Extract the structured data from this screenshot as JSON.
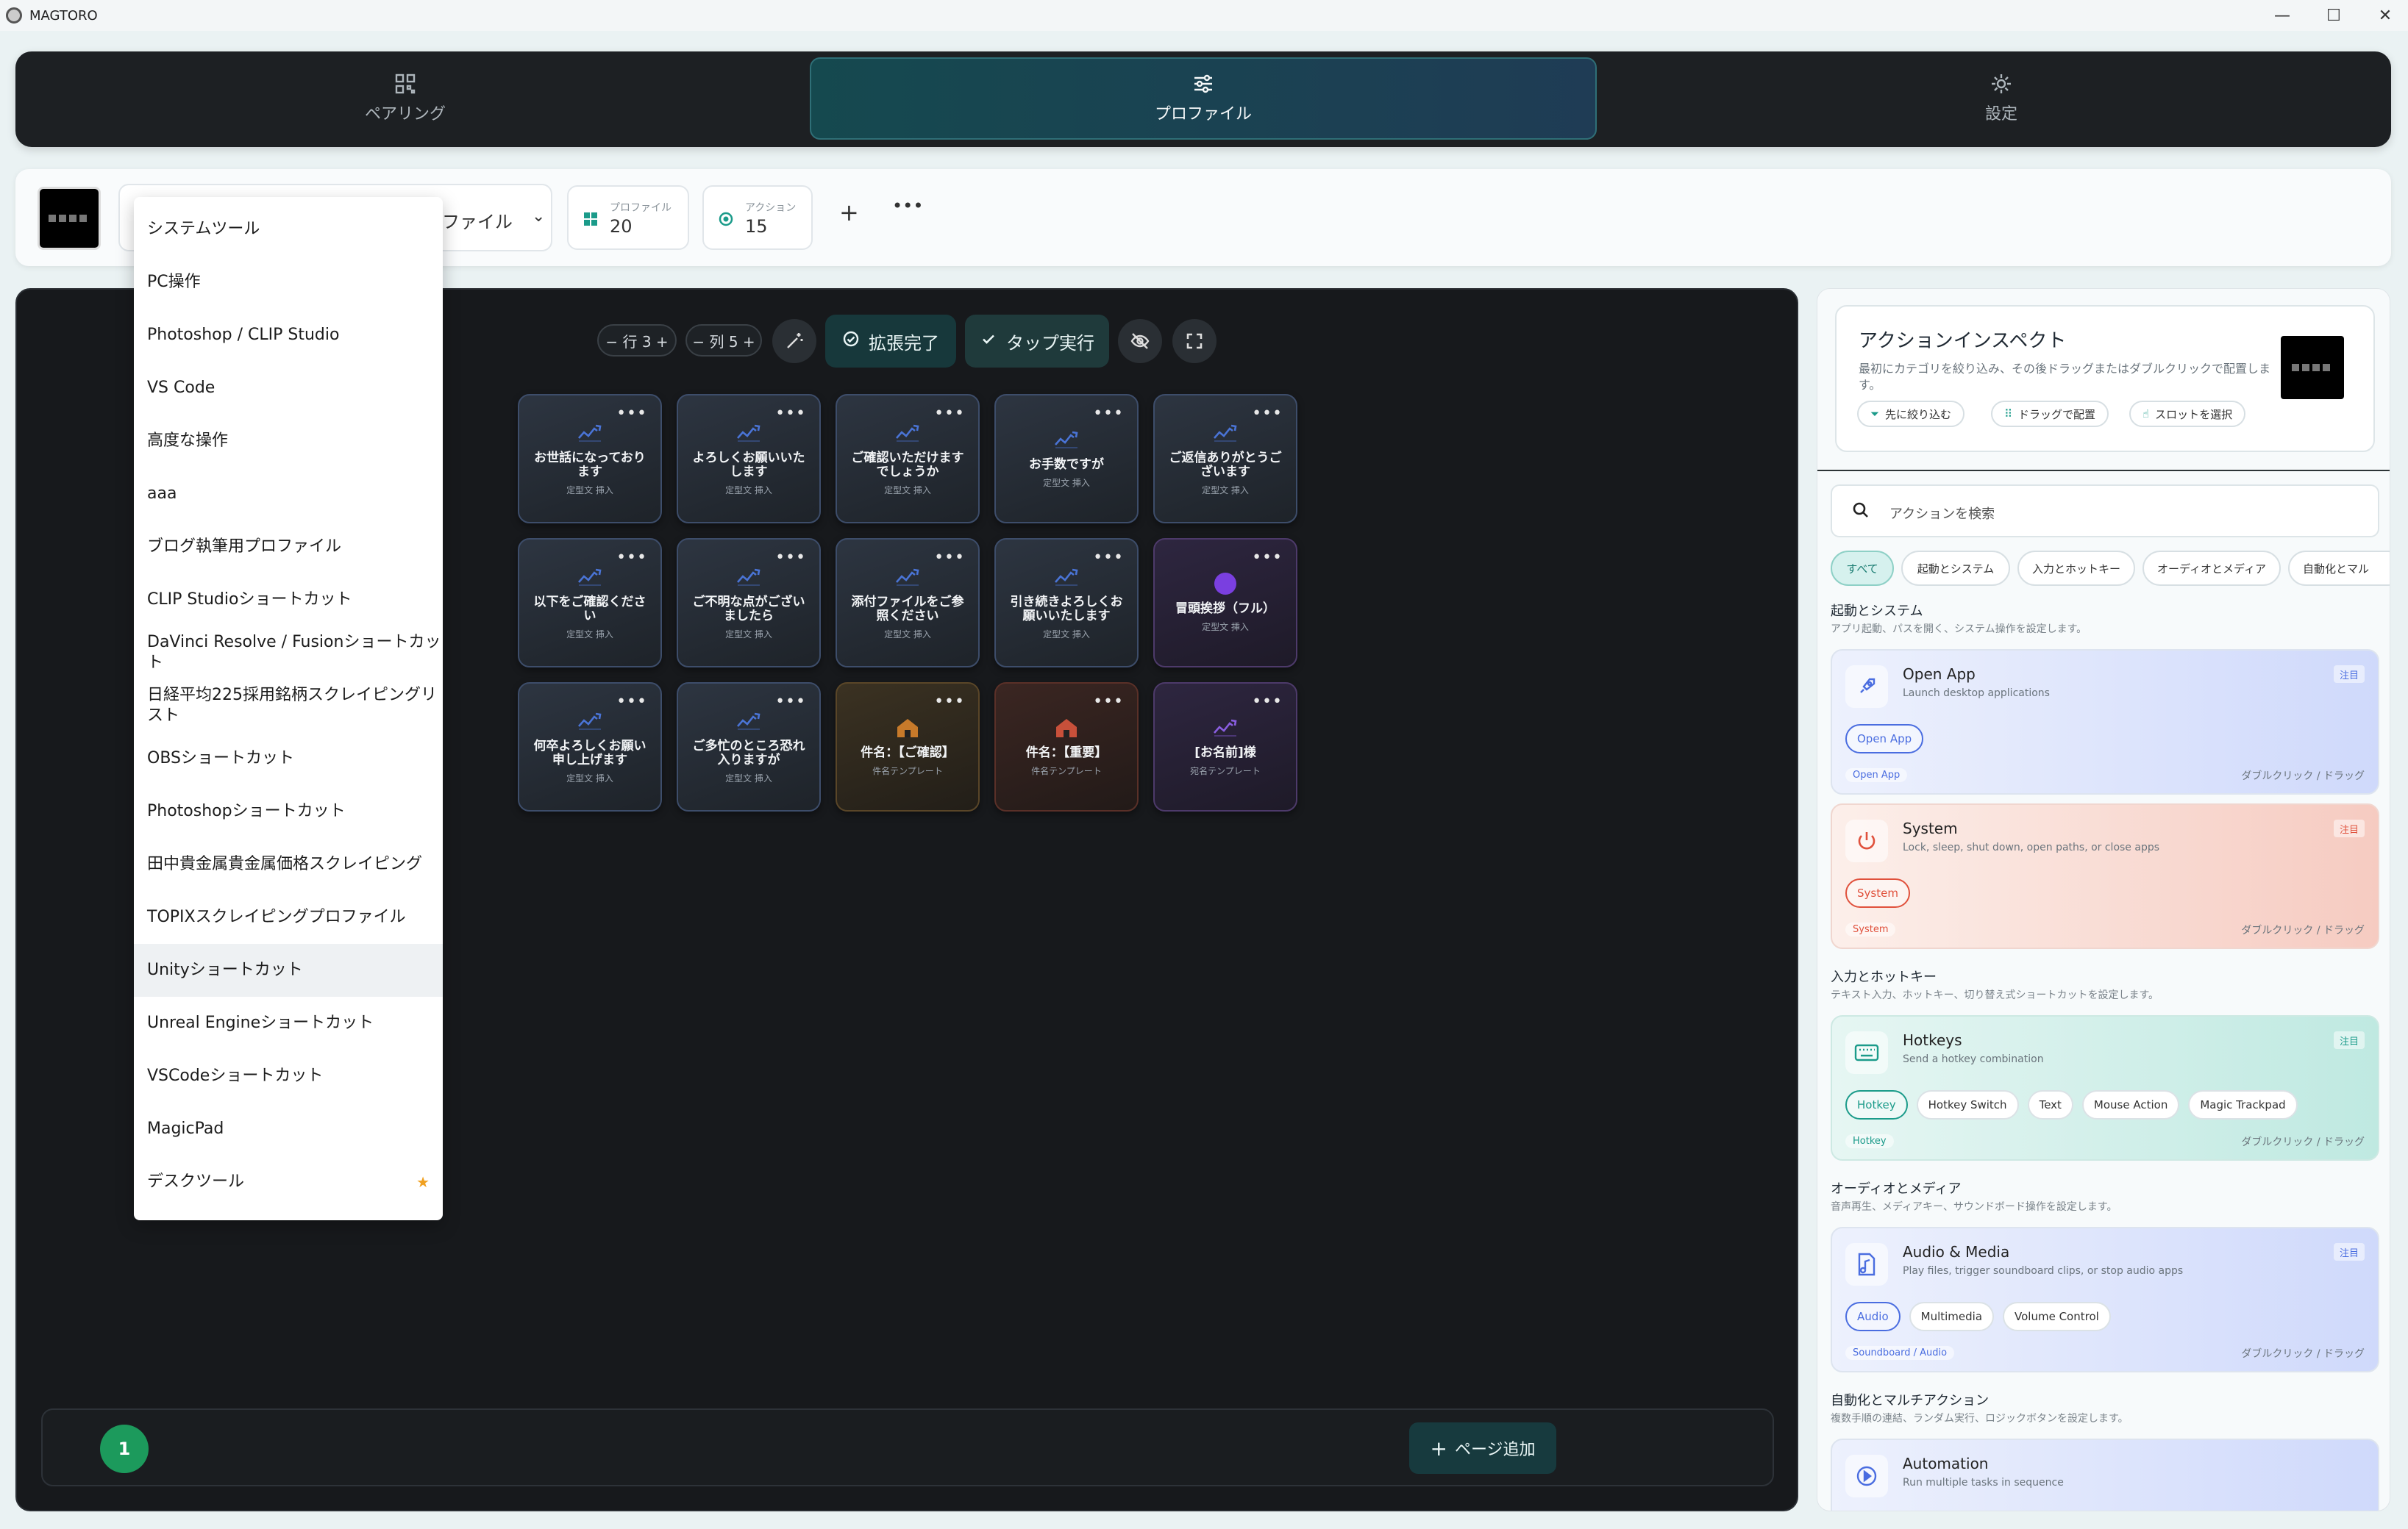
{
  "window": {
    "title": "MAGTORO",
    "minimize": "—",
    "maximize": "☐",
    "close": "✕"
  },
  "nav": {
    "tabs": [
      {
        "label": "ペアリング",
        "icon": "grid-icon"
      },
      {
        "label": "プロファイル",
        "icon": "sliders-icon"
      },
      {
        "label": "設定",
        "icon": "gear-icon"
      }
    ]
  },
  "profile_bar": {
    "select_text": "ファイル",
    "profiles_label": "プロファイル",
    "profiles_count": "20",
    "actions_label": "アクション",
    "actions_count": "15",
    "add": "+",
    "more": "•••"
  },
  "dropdown": {
    "items": [
      "システムツール",
      "PC操作",
      "Photoshop / CLIP Studio",
      "VS Code",
      "高度な操作",
      "aaa",
      "ブログ執筆用プロファイル",
      "CLIP Studioショートカット",
      "DaVinci Resolve / Fusionショートカット",
      "日経平均225採用銘柄スクレイピングリスト",
      "OBSショートカット",
      "Photoshopショートカット",
      "田中貴金属貴金属価格スクレイピング",
      "TOPIXスクレイピングプロファイル",
      "Unityショートカット",
      "Unreal Engineショートカット",
      "VSCodeショートカット",
      "MagicPad",
      "デスクツール"
    ],
    "highlighted": "Unityショートカット",
    "starred": "デスクツール"
  },
  "toolbar": {
    "rows": "− 行 3 +",
    "cols": "− 列 5 +",
    "expand_done": "拡張完了",
    "tap_run": "タップ実行"
  },
  "slots": [
    {
      "title": "お世話になっております",
      "sub": "定型文 挿入",
      "style": "blue",
      "icon": "wave"
    },
    {
      "title": "よろしくお願いいたします",
      "sub": "定型文 挿入",
      "style": "blue",
      "icon": "wave"
    },
    {
      "title": "ご確認いただけますでしょうか",
      "sub": "定型文 挿入",
      "style": "blue",
      "icon": "wave"
    },
    {
      "title": "お手数ですが",
      "sub": "定型文 挿入",
      "style": "blue",
      "icon": "wave"
    },
    {
      "title": "ご返信ありがとうございます",
      "sub": "定型文 挿入",
      "style": "blue",
      "icon": "wave"
    },
    {
      "title": "以下をご確認ください",
      "sub": "定型文 挿入",
      "style": "blue",
      "icon": "wave"
    },
    {
      "title": "ご不明な点がございましたら",
      "sub": "定型文 挿入",
      "style": "blue",
      "icon": "wave"
    },
    {
      "title": "添付ファイルをご参照ください",
      "sub": "定型文 挿入",
      "style": "blue",
      "icon": "wave"
    },
    {
      "title": "引き続きよろしくお願いいたします",
      "sub": "定型文 挿入",
      "style": "blue",
      "icon": "wave"
    },
    {
      "title": "冒頭挨拶（フル）",
      "sub": "定型文 挿入",
      "style": "purple",
      "icon": "dot"
    },
    {
      "title": "何卒よろしくお願い申し上げます",
      "sub": "定型文 挿入",
      "style": "blue",
      "icon": "wave"
    },
    {
      "title": "ご多忙のところ恐れ入りますが",
      "sub": "定型文 挿入",
      "style": "blue",
      "icon": "wave"
    },
    {
      "title": "件名：【ご確認】",
      "sub": "件名テンプレート",
      "style": "orange",
      "icon": "house"
    },
    {
      "title": "件名：【重要】",
      "sub": "件名テンプレート",
      "style": "red",
      "icon": "house"
    },
    {
      "title": "[お名前]様",
      "sub": "宛名テンプレート",
      "style": "purple",
      "icon": "wave"
    }
  ],
  "pager": {
    "current": "1",
    "add_page": "ページ追加"
  },
  "inspect": {
    "title": "アクションインスペクト",
    "desc": "最初にカテゴリを絞り込み、その後ドラッグまたはダブルクリックで配置します。",
    "chips": [
      "先に絞り込む",
      "ドラッグで配置",
      "スロットを選択"
    ]
  },
  "search": {
    "placeholder": "アクションを検索"
  },
  "filters": [
    "すべて",
    "起動とシステム",
    "入力とホットキー",
    "オーディオとメディア",
    "自動化とマル"
  ],
  "sections": [
    {
      "title": "起動とシステム",
      "desc": "アプリ起動、パスを開く、システム操作を設定します。"
    },
    {
      "title": "入力とホットキー",
      "desc": "テキスト入力、ホットキー、切り替え式ショートカットを設定します。"
    },
    {
      "title": "オーディオとメディア",
      "desc": "音声再生、メディアキー、サウンドボード操作を設定します。"
    },
    {
      "title": "自動化とマルチアクション",
      "desc": "複数手順の連結、ランダム実行、ロジックボタンを設定します。"
    }
  ],
  "cards": [
    {
      "title": "Open App",
      "desc": "Launch desktop applications",
      "badge": "注目",
      "tags": [
        "Open App"
      ],
      "foot": "Open App",
      "dc": "ダブルクリック / ドラッグ",
      "accent": "#4a6de0"
    },
    {
      "title": "System",
      "desc": "Lock, sleep, shut down, open paths, or close apps",
      "badge": "注目",
      "tags": [
        "System"
      ],
      "foot": "System",
      "dc": "ダブルクリック / ドラッグ",
      "accent": "#e0513c"
    },
    {
      "title": "Hotkeys",
      "desc": "Send a hotkey combination",
      "badge": "注目",
      "tags": [
        "Hotkey",
        "Hotkey Switch",
        "Text",
        "Mouse Action",
        "Magic Trackpad"
      ],
      "foot": "Hotkey",
      "dc": "ダブルクリック / ドラッグ",
      "accent": "#1b9b8a"
    },
    {
      "title": "Audio & Media",
      "desc": "Play files, trigger soundboard clips, or stop audio apps",
      "badge": "注目",
      "tags": [
        "Audio",
        "Multimedia",
        "Volume Control"
      ],
      "foot": "Soundboard / Audio",
      "dc": "ダブルクリック / ドラッグ",
      "accent": "#4a6de0"
    },
    {
      "title": "Automation",
      "desc": "Run multiple tasks in sequence",
      "badge": "",
      "tags": [],
      "foot": "",
      "dc": "",
      "accent": "#4a6de0"
    }
  ]
}
